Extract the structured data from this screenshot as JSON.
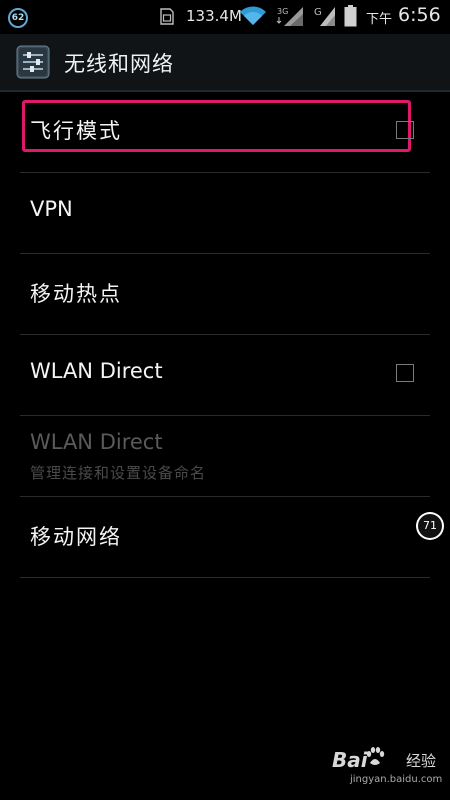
{
  "status_bar": {
    "badge_count": "62",
    "data_speed": "133.4M",
    "network_3g_label": "3G",
    "network_g_label": "G",
    "ampm": "下午",
    "time": "6:56",
    "icons": [
      "sim-icon",
      "wifi-icon",
      "signal-3g-icon",
      "signal-g-icon",
      "battery-icon"
    ]
  },
  "action_bar": {
    "title": "无线和网络",
    "icon": "settings-sliders-icon"
  },
  "list": {
    "items": [
      {
        "label": "飞行模式",
        "has_checkbox": true,
        "checked": false,
        "highlighted": true
      },
      {
        "label": "VPN"
      },
      {
        "label": "移动热点"
      },
      {
        "label": "WLAN Direct",
        "has_checkbox": true,
        "checked": false
      },
      {
        "label": "WLAN Direct",
        "subtitle": "管理连接和设置设备命名",
        "disabled": true
      },
      {
        "label": "移动网络"
      }
    ]
  },
  "floating_badge": {
    "value": "71"
  },
  "watermark": {
    "brand_left": "Bai",
    "brand_right": "经验",
    "url": "jingyan.baidu.com"
  },
  "colors": {
    "highlight": "#e0186c",
    "background": "#000000",
    "divider": "#2b2b2b"
  }
}
